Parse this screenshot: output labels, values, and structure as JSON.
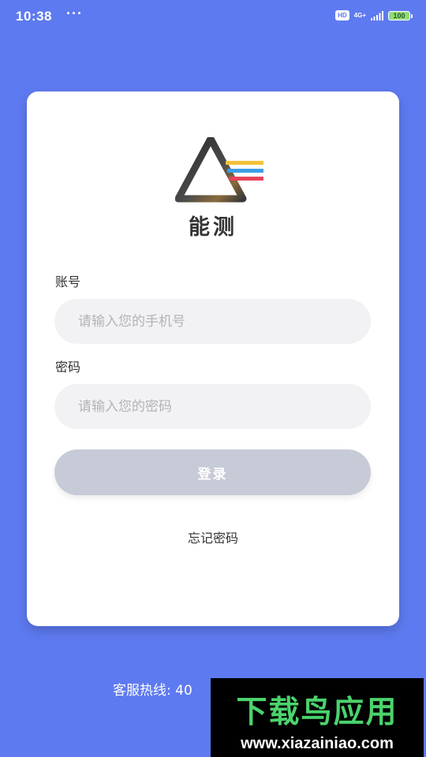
{
  "status_bar": {
    "time": "10:38",
    "dots": "···",
    "hd_label": "HD",
    "network_label": "4G+",
    "battery": "100"
  },
  "brand": {
    "name": "能测",
    "logo_icon": "triangle-prism-logo-icon"
  },
  "form": {
    "account_label": "账号",
    "account_placeholder": "请输入您的手机号",
    "account_value": "",
    "password_label": "密码",
    "password_placeholder": "请输入您的密码",
    "password_value": "",
    "login_label": "登录",
    "forgot_label": "忘记密码"
  },
  "footer": {
    "hotline": "客服热线: 40"
  },
  "watermark": {
    "title": "下载鸟应用",
    "url": "www.xiazainiao.com"
  },
  "colors": {
    "background": "#5e7af0",
    "card": "#ffffff",
    "input_bg": "#f2f2f5",
    "button_disabled": "#c7cad7",
    "logo_yellow": "#f2c23a",
    "logo_blue": "#3c9fe6",
    "logo_red": "#e8435a"
  }
}
